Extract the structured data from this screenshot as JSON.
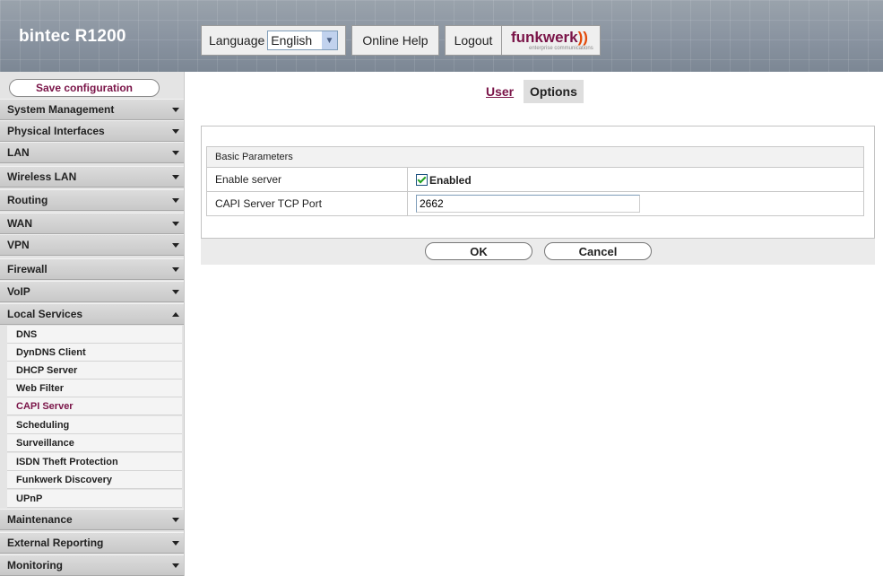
{
  "header": {
    "brand": "bintec R1200",
    "language_label": "Language",
    "language_value": "English",
    "online_help": "Online Help",
    "logout": "Logout",
    "logo_text": "funkwerk",
    "logo_sub": "enterprise communications"
  },
  "sidebar": {
    "save_label": "Save configuration",
    "menu": [
      {
        "label": "System Management",
        "expanded": false
      },
      {
        "label": "Physical Interfaces",
        "expanded": false
      },
      {
        "label": "LAN",
        "expanded": false
      },
      {
        "label": "Wireless LAN",
        "expanded": false
      },
      {
        "label": "Routing",
        "expanded": false
      },
      {
        "label": "WAN",
        "expanded": false
      },
      {
        "label": "VPN",
        "expanded": false
      },
      {
        "label": "Firewall",
        "expanded": false
      },
      {
        "label": "VoIP",
        "expanded": false
      },
      {
        "label": "Local Services",
        "expanded": true
      },
      {
        "label": "Maintenance",
        "expanded": false
      },
      {
        "label": "External Reporting",
        "expanded": false
      },
      {
        "label": "Monitoring",
        "expanded": false
      }
    ],
    "submenu": [
      {
        "label": "DNS",
        "active": false
      },
      {
        "label": "DynDNS Client",
        "active": false
      },
      {
        "label": "DHCP Server",
        "active": false
      },
      {
        "label": "Web Filter",
        "active": false
      },
      {
        "label": "CAPI Server",
        "active": true
      },
      {
        "label": "Scheduling",
        "active": false
      },
      {
        "label": "Surveillance",
        "active": false
      },
      {
        "label": "ISDN Theft Protection",
        "active": false
      },
      {
        "label": "Funkwerk Discovery",
        "active": false
      },
      {
        "label": "UPnP",
        "active": false
      }
    ]
  },
  "tabs": {
    "user": "User",
    "options": "Options"
  },
  "form": {
    "section_title": "Basic Parameters",
    "enable_server_label": "Enable server",
    "enable_server_checked": true,
    "enabled_text": "Enabled",
    "port_label": "CAPI Server TCP Port",
    "port_value": "2662",
    "ok_label": "OK",
    "cancel_label": "Cancel"
  },
  "colors": {
    "accent": "#7a1448",
    "header_bg": "#8993a0",
    "sidebar_bg": "#e4e4e4"
  }
}
